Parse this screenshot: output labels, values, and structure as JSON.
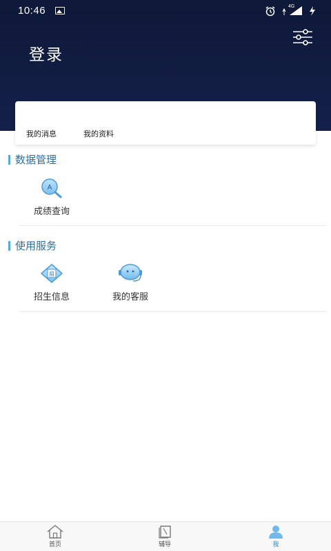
{
  "status_bar": {
    "time": "10:46",
    "network": "4G",
    "icons": [
      "image-icon",
      "alarm-icon",
      "signal-icon",
      "charging-icon"
    ]
  },
  "header": {
    "title": "登录",
    "settings_icon": "sliders-icon",
    "background_color": "#0e1838"
  },
  "card": {
    "links": [
      {
        "label": "我的消息"
      },
      {
        "label": "我的资料"
      }
    ]
  },
  "sections": [
    {
      "title": "数据管理",
      "items": [
        {
          "label": "成绩查询",
          "icon": "score-search-icon"
        }
      ]
    },
    {
      "title": "使用服务",
      "items": [
        {
          "label": "招生信息",
          "icon": "enrollment-icon"
        },
        {
          "label": "我的客服",
          "icon": "customer-service-icon"
        }
      ]
    }
  ],
  "tabbar": {
    "tabs": [
      {
        "label": "首页",
        "icon": "home-icon",
        "active": false
      },
      {
        "label": "辅导",
        "icon": "book-icon",
        "active": false
      },
      {
        "label": "我",
        "icon": "user-icon",
        "active": true
      }
    ],
    "active_color": "#3b86c6"
  },
  "colors": {
    "accent": "#57a9df",
    "section_text": "#2b6ea8"
  }
}
